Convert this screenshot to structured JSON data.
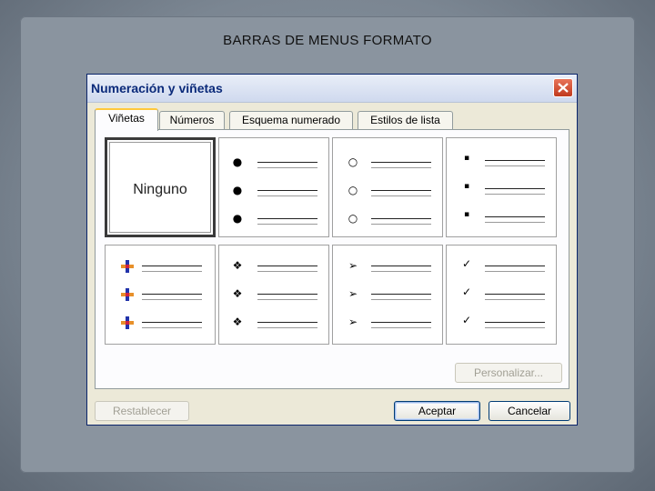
{
  "slide": {
    "title": "BARRAS DE MENUS FORMATO"
  },
  "dialog": {
    "title": "Numeración y viñetas",
    "close_icon": "close-icon",
    "tabs": [
      {
        "label": "Viñetas",
        "active": true
      },
      {
        "label": "Números",
        "active": false
      },
      {
        "label": "Esquema numerado",
        "active": false
      },
      {
        "label": "Estilos de lista",
        "active": false
      }
    ],
    "gallery": {
      "none_label": "Ninguno",
      "bullets": [
        "●",
        "○",
        "▪",
        "picture-bullet",
        "❖",
        "➢",
        "✓"
      ]
    },
    "buttons": {
      "customize": "Personalizar...",
      "reset": "Restablecer",
      "ok": "Aceptar",
      "cancel": "Cancelar"
    }
  }
}
